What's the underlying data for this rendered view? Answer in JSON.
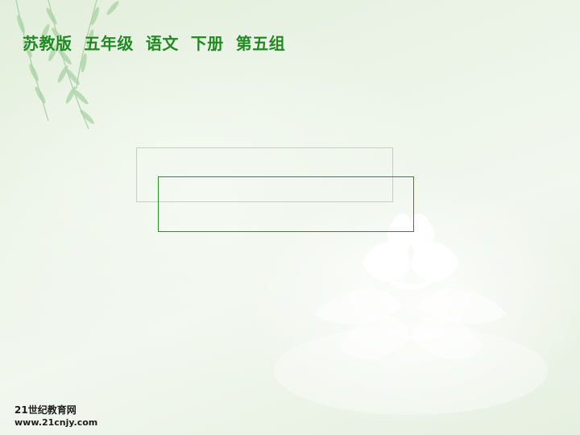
{
  "header": {
    "title": "苏教版  五年级  语文  下册  第五组"
  },
  "watermark": {
    "name": "21世纪教育网",
    "url": "www.21cnjy.com"
  },
  "decorations": {
    "background_art": [
      "willow-branch-icon",
      "lotus-flower-icon"
    ],
    "colors": {
      "title_green": "#1f8a1f",
      "box_green_border": "#2e8b2e",
      "box_grey_border": "#c8cec5"
    }
  }
}
